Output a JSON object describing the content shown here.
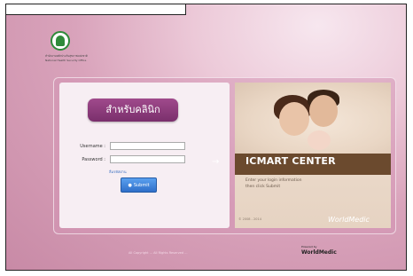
{
  "header": {
    "logo_caption_1": "สำนักงานหลักประกันสุขภาพแห่งชาติ",
    "logo_caption_2": "National Health Security Office"
  },
  "login": {
    "title": "สำหรับคลินิก",
    "username_label": "Username :",
    "username_value": "",
    "password_label": "Password :",
    "password_value": "",
    "forgot_text": "ลืมรหัสผ่าน",
    "submit_label": "Submit"
  },
  "promo": {
    "title": "ICMART CENTER",
    "line1": "Enter your login information",
    "line2": "then click Submit",
    "small": "© 2008 - 2014",
    "brand": "WorldMedic"
  },
  "footer": {
    "copyright": "All Copyright ... All Rights Reserved ...",
    "powered_by_label": "Powered by",
    "powered_by_brand": "WorldMedic"
  }
}
